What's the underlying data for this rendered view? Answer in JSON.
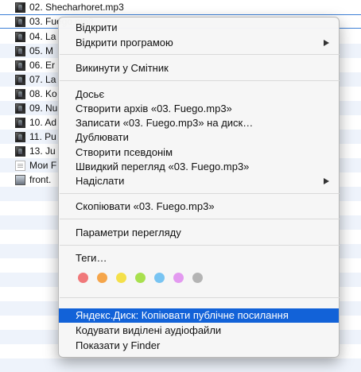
{
  "files": [
    {
      "name": "02. Shecharhoret.mp3",
      "icon": "album-art-icon"
    },
    {
      "name": "03. Fuego.mp3",
      "icon": "album-art-icon",
      "selected": true
    },
    {
      "name": "04. La",
      "icon": "album-art-icon"
    },
    {
      "name": "05. M",
      "icon": "album-art-icon"
    },
    {
      "name": "06. Er",
      "icon": "album-art-icon"
    },
    {
      "name": "07. La",
      "icon": "album-art-icon"
    },
    {
      "name": "08. Ko",
      "icon": "album-art-icon"
    },
    {
      "name": "09. Nu",
      "icon": "album-art-icon"
    },
    {
      "name": "10. Ad",
      "icon": "album-art-icon"
    },
    {
      "name": "11. Pu",
      "icon": "album-art-icon"
    },
    {
      "name": "13. Ju",
      "icon": "album-art-icon"
    },
    {
      "name": "Мои F",
      "icon": "document-icon"
    },
    {
      "name": "front.",
      "icon": "image-file-icon"
    }
  ],
  "menu": {
    "open": "Відкрити",
    "open_with": "Відкрити програмою",
    "move_to_trash": "Викинути у Смітник",
    "dossier": "Досьє",
    "compress": "Створити архів «03. Fuego.mp3»",
    "burn": "Записати «03. Fuego.mp3» на диск…",
    "duplicate": "Дублювати",
    "make_alias": "Створити псевдонім",
    "quick_look": "Швидкий перегляд «03. Fuego.mp3»",
    "share": "Надіслати",
    "copy": "Скопіювати «03. Fuego.mp3»",
    "view_options": "Параметри перегляду",
    "tags": "Теги…",
    "tag_colors": [
      "#f0787a",
      "#f5a54a",
      "#f4e04a",
      "#a8e04e",
      "#78c4f2",
      "#e39af0",
      "#b4b4b4"
    ],
    "yandex_disk": "Яндекс.Диск: Копіювати публічне посилання",
    "encode": "Кодувати виділені аудіофайли",
    "show_in_finder": "Показати у Finder"
  },
  "colors": {
    "highlight": "#1262d8",
    "selection_border": "#3d7fd6"
  }
}
